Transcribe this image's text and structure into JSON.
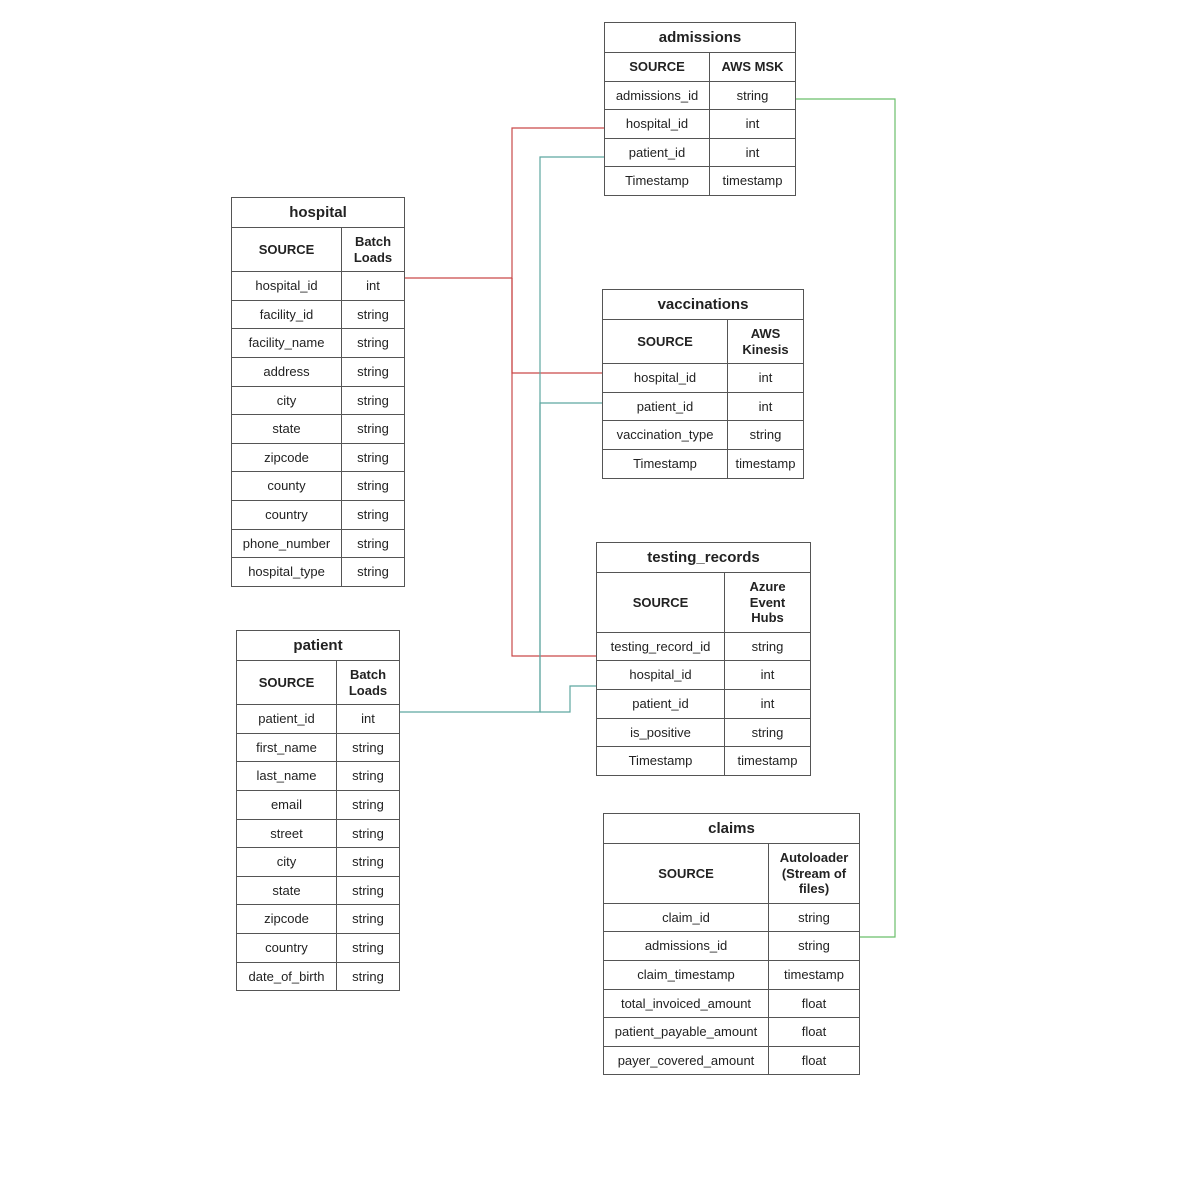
{
  "entities": {
    "hospital": {
      "title": "hospital",
      "source_label": "SOURCE",
      "source_value": "Batch Loads",
      "rows": [
        {
          "name": "hospital_id",
          "type": "int"
        },
        {
          "name": "facility_id",
          "type": "string"
        },
        {
          "name": "facility_name",
          "type": "string"
        },
        {
          "name": "address",
          "type": "string"
        },
        {
          "name": "city",
          "type": "string"
        },
        {
          "name": "state",
          "type": "string"
        },
        {
          "name": "zipcode",
          "type": "string"
        },
        {
          "name": "county",
          "type": "string"
        },
        {
          "name": "country",
          "type": "string"
        },
        {
          "name": "phone_number",
          "type": "string"
        },
        {
          "name": "hospital_type",
          "type": "string"
        }
      ]
    },
    "patient": {
      "title": "patient",
      "source_label": "SOURCE",
      "source_value": "Batch Loads",
      "rows": [
        {
          "name": "patient_id",
          "type": "int"
        },
        {
          "name": "first_name",
          "type": "string"
        },
        {
          "name": "last_name",
          "type": "string"
        },
        {
          "name": "email",
          "type": "string"
        },
        {
          "name": "street",
          "type": "string"
        },
        {
          "name": "city",
          "type": "string"
        },
        {
          "name": "state",
          "type": "string"
        },
        {
          "name": "zipcode",
          "type": "string"
        },
        {
          "name": "country",
          "type": "string"
        },
        {
          "name": "date_of_birth",
          "type": "string"
        }
      ]
    },
    "admissions": {
      "title": "admissions",
      "source_label": "SOURCE",
      "source_value": "AWS MSK",
      "rows": [
        {
          "name": "admissions_id",
          "type": "string"
        },
        {
          "name": "hospital_id",
          "type": "int"
        },
        {
          "name": "patient_id",
          "type": "int"
        },
        {
          "name": "Timestamp",
          "type": "timestamp"
        }
      ]
    },
    "vaccinations": {
      "title": "vaccinations",
      "source_label": "SOURCE",
      "source_value": "AWS Kinesis",
      "rows": [
        {
          "name": "hospital_id",
          "type": "int"
        },
        {
          "name": "patient_id",
          "type": "int"
        },
        {
          "name": "vaccination_type",
          "type": "string"
        },
        {
          "name": "Timestamp",
          "type": "timestamp"
        }
      ]
    },
    "testing_records": {
      "title": "testing_records",
      "source_label": "SOURCE",
      "source_value": "Azure Event Hubs",
      "rows": [
        {
          "name": "testing_record_id",
          "type": "string"
        },
        {
          "name": "hospital_id",
          "type": "int"
        },
        {
          "name": "patient_id",
          "type": "int"
        },
        {
          "name": "is_positive",
          "type": "string"
        },
        {
          "name": "Timestamp",
          "type": "timestamp"
        }
      ]
    },
    "claims": {
      "title": "claims",
      "source_label": "SOURCE",
      "source_value": "Autoloader (Stream of files)",
      "rows": [
        {
          "name": "claim_id",
          "type": "string"
        },
        {
          "name": "admissions_id",
          "type": "string"
        },
        {
          "name": "claim_timestamp",
          "type": "timestamp"
        },
        {
          "name": "total_invoiced_amount",
          "type": "float"
        },
        {
          "name": "patient_payable_amount",
          "type": "float"
        },
        {
          "name": "payer_covered_amount",
          "type": "float"
        }
      ]
    }
  },
  "connectors": {
    "red_stroke": "#c94949",
    "teal_stroke": "#5ea7a0",
    "green_stroke": "#6bbf6b"
  }
}
